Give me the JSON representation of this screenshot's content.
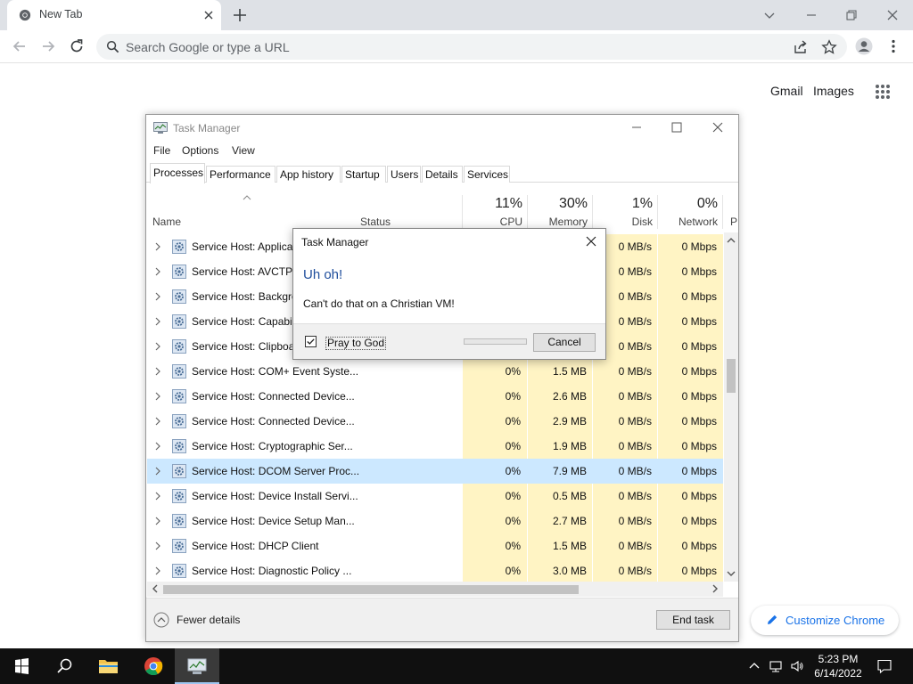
{
  "chrome": {
    "tab_title": "New Tab",
    "omnibox_placeholder": "Search Google or type a URL",
    "links": {
      "gmail": "Gmail",
      "images": "Images"
    },
    "customize_label": "Customize Chrome",
    "colors": {
      "tabstrip": "#dee1e6",
      "accent": "#1a73e8"
    }
  },
  "task_manager": {
    "title": "Task Manager",
    "menu": [
      "File",
      "Options",
      "View"
    ],
    "tabs": [
      "Processes",
      "Performance",
      "App history",
      "Startup",
      "Users",
      "Details",
      "Services"
    ],
    "active_tab": "Processes",
    "columns": {
      "name": "Name",
      "status": "Status",
      "cpu": {
        "pct": "11%",
        "label": "CPU"
      },
      "memory": {
        "pct": "30%",
        "label": "Memory"
      },
      "disk": {
        "pct": "1%",
        "label": "Disk"
      },
      "network": {
        "pct": "0%",
        "label": "Network"
      },
      "power": "P"
    },
    "rows": [
      {
        "name": "Service Host: Applicat",
        "cpu": "",
        "mem": "",
        "disk": "0 MB/s",
        "net": "0 Mbps"
      },
      {
        "name": "Service Host: AVCTP s",
        "cpu": "",
        "mem": "",
        "disk": "0 MB/s",
        "net": "0 Mbps"
      },
      {
        "name": "Service Host: Backgro",
        "cpu": "",
        "mem": "",
        "disk": "0 MB/s",
        "net": "0 Mbps"
      },
      {
        "name": "Service Host: Capabili",
        "cpu": "",
        "mem": "",
        "disk": "0 MB/s",
        "net": "0 Mbps"
      },
      {
        "name": "Service Host: Clipboa",
        "cpu": "",
        "mem": "",
        "disk": "0 MB/s",
        "net": "0 Mbps"
      },
      {
        "name": "Service Host: COM+ Event Syste...",
        "cpu": "0%",
        "mem": "1.5 MB",
        "disk": "0 MB/s",
        "net": "0 Mbps"
      },
      {
        "name": "Service Host: Connected Device...",
        "cpu": "0%",
        "mem": "2.6 MB",
        "disk": "0 MB/s",
        "net": "0 Mbps"
      },
      {
        "name": "Service Host: Connected Device...",
        "cpu": "0%",
        "mem": "2.9 MB",
        "disk": "0 MB/s",
        "net": "0 Mbps"
      },
      {
        "name": "Service Host: Cryptographic Ser...",
        "cpu": "0%",
        "mem": "1.9 MB",
        "disk": "0 MB/s",
        "net": "0 Mbps"
      },
      {
        "name": "Service Host: DCOM Server Proc...",
        "cpu": "0%",
        "mem": "7.9 MB",
        "disk": "0 MB/s",
        "net": "0 Mbps"
      },
      {
        "name": "Service Host: Device Install Servi...",
        "cpu": "0%",
        "mem": "0.5 MB",
        "disk": "0 MB/s",
        "net": "0 Mbps"
      },
      {
        "name": "Service Host: Device Setup Man...",
        "cpu": "0%",
        "mem": "2.7 MB",
        "disk": "0 MB/s",
        "net": "0 Mbps"
      },
      {
        "name": "Service Host: DHCP Client",
        "cpu": "0%",
        "mem": "1.5 MB",
        "disk": "0 MB/s",
        "net": "0 Mbps"
      },
      {
        "name": "Service Host: Diagnostic Policy ...",
        "cpu": "0%",
        "mem": "3.0 MB",
        "disk": "0 MB/s",
        "net": "0 Mbps"
      }
    ],
    "selected_row": 9,
    "fewer_details": "Fewer details",
    "end_task": "End task",
    "colors": {
      "heat": "#fff4c4",
      "selected": "#cce8ff"
    }
  },
  "dialog": {
    "title": "Task Manager",
    "heading": "Uh oh!",
    "message": "Can't do that on a Christian VM!",
    "checkbox_label": "Pray to God",
    "checkbox_checked": true,
    "cancel_label": "Cancel"
  },
  "taskbar": {
    "time": "5:23 PM",
    "date": "6/14/2022",
    "icons": [
      "windows-start-icon",
      "search-icon",
      "file-explorer-icon",
      "chrome-icon",
      "task-manager-icon"
    ]
  }
}
